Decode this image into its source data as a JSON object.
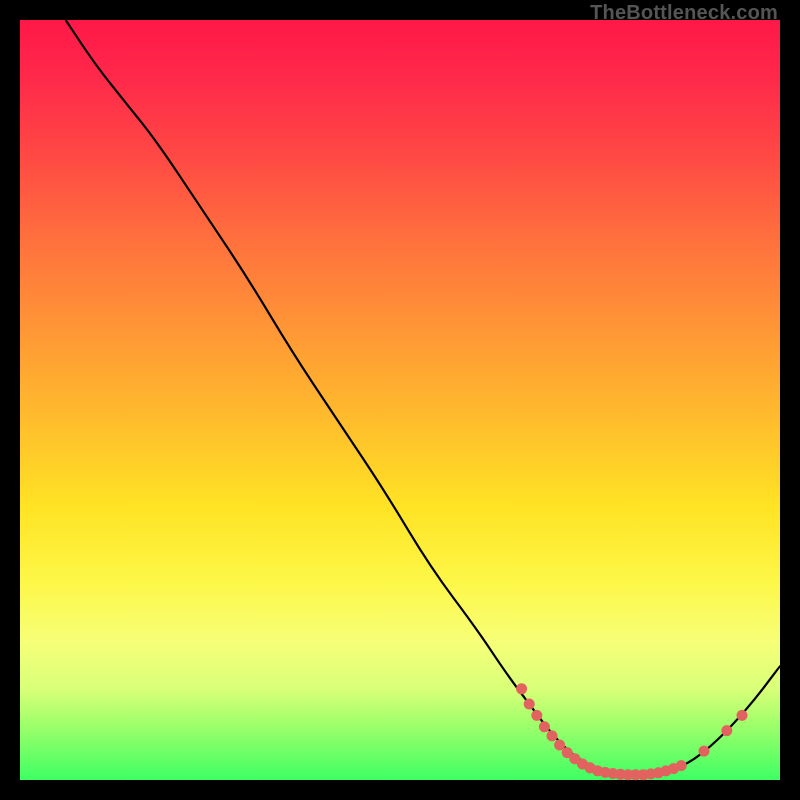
{
  "watermark": "TheBottleneck.com",
  "chart_data": {
    "type": "line",
    "title": "",
    "xlabel": "",
    "ylabel": "",
    "xlim": [
      0,
      100
    ],
    "ylim": [
      0,
      100
    ],
    "grid": false,
    "curve": [
      {
        "x": 6,
        "y": 100
      },
      {
        "x": 10,
        "y": 94
      },
      {
        "x": 14,
        "y": 89
      },
      {
        "x": 18,
        "y": 84
      },
      {
        "x": 24,
        "y": 75
      },
      {
        "x": 30,
        "y": 66
      },
      {
        "x": 36,
        "y": 56
      },
      {
        "x": 42,
        "y": 47
      },
      {
        "x": 48,
        "y": 38
      },
      {
        "x": 54,
        "y": 28
      },
      {
        "x": 60,
        "y": 20
      },
      {
        "x": 64,
        "y": 14
      },
      {
        "x": 67,
        "y": 10
      },
      {
        "x": 70,
        "y": 6
      },
      {
        "x": 73,
        "y": 3
      },
      {
        "x": 76,
        "y": 1.5
      },
      {
        "x": 79,
        "y": 0.8
      },
      {
        "x": 82,
        "y": 0.7
      },
      {
        "x": 85,
        "y": 1.0
      },
      {
        "x": 88,
        "y": 2.2
      },
      {
        "x": 91,
        "y": 4.5
      },
      {
        "x": 94,
        "y": 7.5
      },
      {
        "x": 97,
        "y": 11
      },
      {
        "x": 100,
        "y": 15
      }
    ],
    "markers": [
      {
        "x": 66,
        "y": 12
      },
      {
        "x": 67,
        "y": 10
      },
      {
        "x": 68,
        "y": 8.5
      },
      {
        "x": 69,
        "y": 7
      },
      {
        "x": 70,
        "y": 5.8
      },
      {
        "x": 71,
        "y": 4.6
      },
      {
        "x": 72,
        "y": 3.6
      },
      {
        "x": 73,
        "y": 2.8
      },
      {
        "x": 74,
        "y": 2.1
      },
      {
        "x": 75,
        "y": 1.6
      },
      {
        "x": 76,
        "y": 1.2
      },
      {
        "x": 77,
        "y": 1.0
      },
      {
        "x": 78,
        "y": 0.85
      },
      {
        "x": 79,
        "y": 0.75
      },
      {
        "x": 80,
        "y": 0.7
      },
      {
        "x": 81,
        "y": 0.7
      },
      {
        "x": 82,
        "y": 0.7
      },
      {
        "x": 83,
        "y": 0.8
      },
      {
        "x": 84,
        "y": 0.95
      },
      {
        "x": 85,
        "y": 1.2
      },
      {
        "x": 86,
        "y": 1.5
      },
      {
        "x": 87,
        "y": 1.9
      },
      {
        "x": 90,
        "y": 3.8
      },
      {
        "x": 93,
        "y": 6.5
      },
      {
        "x": 95,
        "y": 8.5
      }
    ],
    "marker_radius": 5.5,
    "colors": {
      "curve": "#000000",
      "marker": "#e2625f",
      "bg_top": "#ff1848",
      "bg_bottom": "#3eff64",
      "frame": "#000000"
    }
  }
}
